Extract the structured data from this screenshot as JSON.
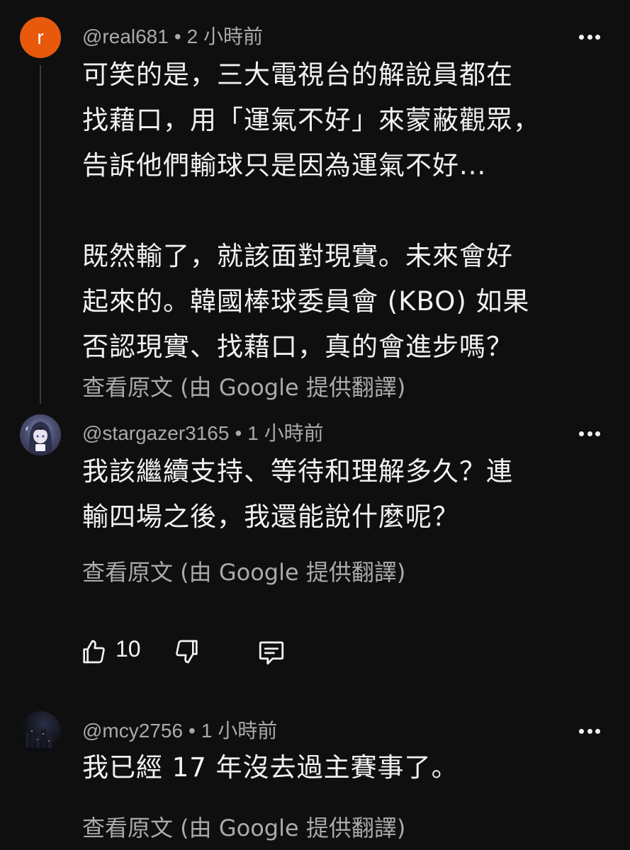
{
  "comments": [
    {
      "avatar_letter": "r",
      "username": "@real681",
      "separator": "•",
      "time": "2 小時前",
      "lines": [
        "可笑的是，三大電視台的解說員都在",
        "找藉口，用「運氣不好」來蒙蔽觀眾，",
        "告訴他們輸球只是因為運氣不好...",
        "",
        "既然輸了，就該面對現實。未來會好",
        "起來的。韓國棒球委員會 (KBO) 如果",
        "否認現實、找藉口，真的會進步嗎？"
      ],
      "translate_label": "查看原文 (由 Google 提供翻譯)"
    },
    {
      "username": "@stargazer3165",
      "separator": "•",
      "time": "1 小時前",
      "lines": [
        "我該繼續支持、等待和理解多久？連",
        "輸四場之後，我還能說什麼呢？"
      ],
      "translate_label": "查看原文 (由 Google 提供翻譯)",
      "like_count": "10"
    },
    {
      "username": "@mcy2756",
      "separator": "•",
      "time": "1 小時前",
      "lines": [
        "我已經 17 年沒去過主賽事了。"
      ],
      "translate_label": "查看原文 (由 Google 提供翻譯)"
    }
  ],
  "icons": {
    "like": "thumbs-up-icon",
    "dislike": "thumbs-down-icon",
    "reply": "comment-icon",
    "more": "more-horizontal-icon"
  },
  "colors": {
    "background": "#0f0f0f",
    "text": "#f1f1f1",
    "secondary": "#aaaaaa",
    "avatar_accent": "#e8590c"
  }
}
